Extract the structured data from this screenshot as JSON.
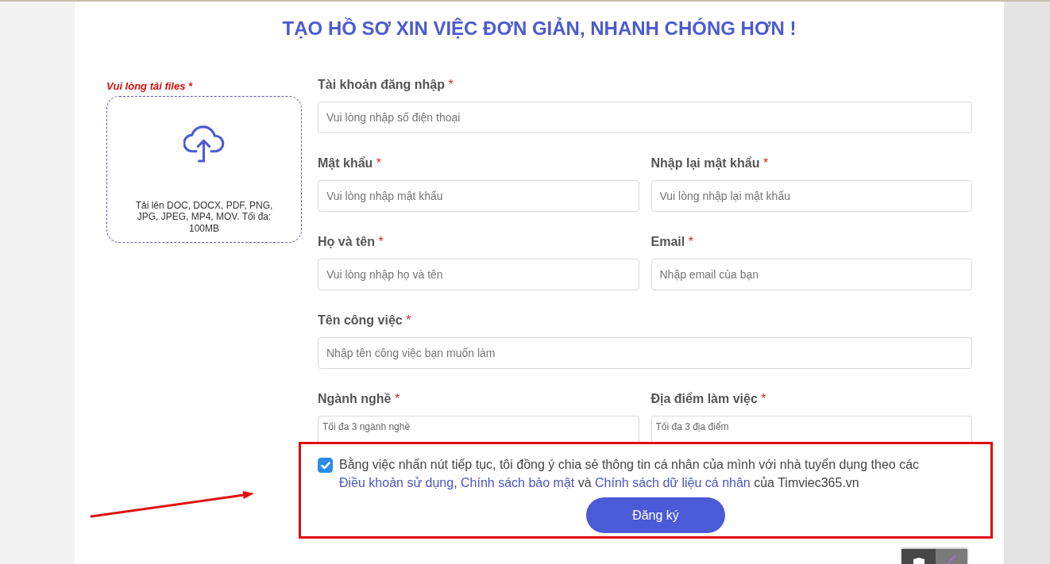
{
  "title": "TẠO HỒ SƠ XIN VIỆC ĐƠN GIẢN, NHANH CHÓNG HƠN !",
  "upload": {
    "label": "Vui lòng tải files",
    "required_mark": "*",
    "hint": "Tải lên DOC, DOCX, PDF, PNG, JPG, JPEG, MP4, MOV. Tối đa: 100MB"
  },
  "form_rows": [
    {
      "fields": [
        {
          "kind": "text",
          "label": "Tài khoản đăng nhập",
          "required_mark": "*",
          "placeholder": "Vui lòng nhập số điện thoại"
        }
      ]
    },
    {
      "fields": [
        {
          "kind": "text",
          "label": "Mật khẩu",
          "required_mark": "*",
          "placeholder": "Vui lòng nhập mật khẩu"
        },
        {
          "kind": "text",
          "label": "Nhập lại mật khẩu",
          "required_mark": "*",
          "placeholder": "Vui lòng nhập lại mật khẩu"
        }
      ]
    },
    {
      "fields": [
        {
          "kind": "text",
          "label": "Họ và tên",
          "required_mark": "*",
          "placeholder": "Vui lòng nhập họ và tên"
        },
        {
          "kind": "text",
          "label": "Email",
          "required_mark": "*",
          "placeholder": "Nhập email của bạn"
        }
      ]
    },
    {
      "fields": [
        {
          "kind": "text",
          "label": "Tên công việc",
          "required_mark": "*",
          "placeholder": "Nhập tên công việc bạn muốn làm"
        }
      ]
    },
    {
      "fields": [
        {
          "kind": "multiselect",
          "label": "Ngành nghề",
          "required_mark": "*",
          "placeholder": "Tối đa 3 ngành nghề"
        },
        {
          "kind": "multiselect",
          "label": "Địa điểm làm việc",
          "required_mark": "*",
          "placeholder": "Tối đa 3 địa điểm"
        }
      ]
    }
  ],
  "consent": {
    "checked": true,
    "segments": [
      {
        "kind": "plain",
        "text": "Bằng việc nhấn nút tiếp tục, tôi đồng ý chia sẻ thông tin cá nhân của mình với nhà tuyển dụng theo các "
      },
      {
        "kind": "link",
        "text": "Điều khoản sử dụng"
      },
      {
        "kind": "plain",
        "text": ", "
      },
      {
        "kind": "link",
        "text": "Chính sách bảo mật"
      },
      {
        "kind": "plain",
        "text": " và "
      },
      {
        "kind": "link",
        "text": "Chính sách dữ liệu cá nhân"
      },
      {
        "kind": "plain",
        "text": " của Timviec365.vn"
      }
    ]
  },
  "submit_button": "Đăng ký"
}
